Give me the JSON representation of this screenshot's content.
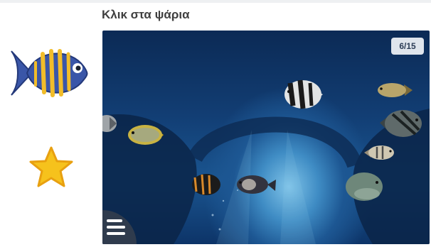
{
  "activity": {
    "title": "Κλικ στα ψάρια",
    "progress_text": "6/15"
  },
  "colors": {
    "side_fish_body": "#3a56a8",
    "side_fish_stripes": "#f2bd2a",
    "star": "#f6c21c"
  },
  "icons": {
    "side_fish": "fish-icon",
    "side_star": "star-icon",
    "menu": "menu-icon"
  }
}
